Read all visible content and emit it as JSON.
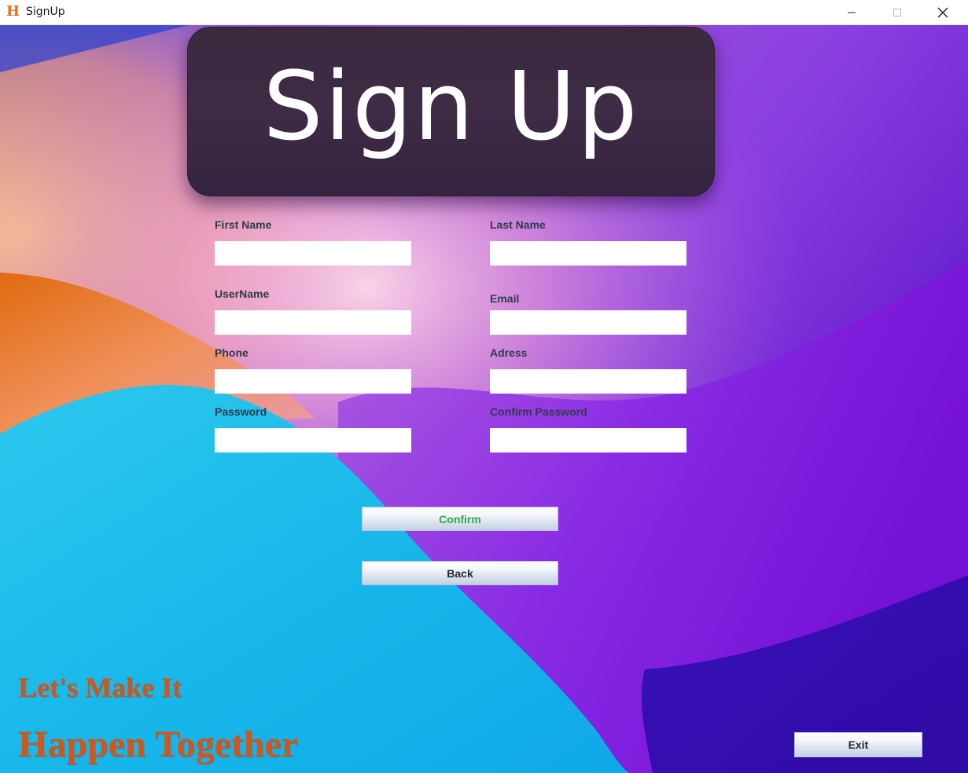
{
  "window": {
    "title": "SignUp",
    "icon": "h-app-icon",
    "controls": [
      "minimize-icon",
      "maximize-icon",
      "close-icon"
    ]
  },
  "banner": {
    "title": "Sign Up"
  },
  "form": {
    "first_name": {
      "label": "First Name",
      "value": ""
    },
    "last_name": {
      "label": "Last Name",
      "value": ""
    },
    "username": {
      "label": "UserName",
      "value": ""
    },
    "email": {
      "label": "Email",
      "value": ""
    },
    "phone": {
      "label": "Phone",
      "value": ""
    },
    "address": {
      "label": "Adress",
      "value": ""
    },
    "password": {
      "label": "Password",
      "value": ""
    },
    "confirm_password": {
      "label": "Confirm Password",
      "value": ""
    }
  },
  "buttons": {
    "confirm": "Confirm",
    "back": "Back",
    "exit": "Exit"
  },
  "slogan": {
    "line1": "Let's Make It",
    "line2": "Happen Together"
  },
  "colors": {
    "confirm_text": "#2fa84f",
    "slogan": "#d1561a",
    "label": "#2f3a4d"
  }
}
